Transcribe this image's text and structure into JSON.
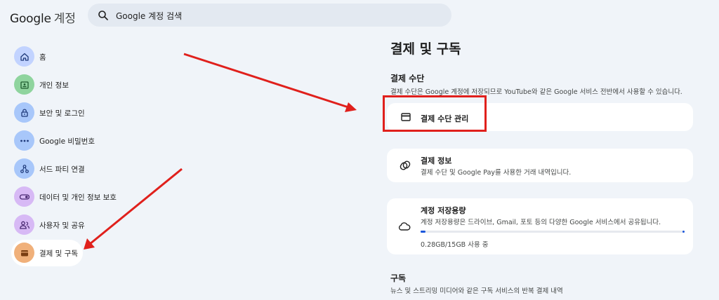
{
  "header": {
    "logo_google": "Google",
    "logo_app": "계정",
    "search_placeholder": "Google 계정 검색"
  },
  "sidebar": {
    "items": [
      {
        "label": "홈",
        "icon": "home-icon",
        "color": "#c2d3ff"
      },
      {
        "label": "개인 정보",
        "icon": "id-card-icon",
        "color": "#8fd49e"
      },
      {
        "label": "보안 및 로그인",
        "icon": "lock-icon",
        "color": "#a8c7fa"
      },
      {
        "label": "Google 비밀번호",
        "icon": "password-icon",
        "color": "#a8c7fa"
      },
      {
        "label": "서드 파티 연결",
        "icon": "connections-icon",
        "color": "#a8c7fa"
      },
      {
        "label": "데이터 및 개인 정보 보호",
        "icon": "toggle-icon",
        "color": "#d7b9f5"
      },
      {
        "label": "사용자 및 공유",
        "icon": "people-icon",
        "color": "#d7b9f5"
      },
      {
        "label": "결제 및 구독",
        "icon": "wallet-icon",
        "color": "#f0b07a",
        "active": true
      }
    ]
  },
  "main": {
    "title": "결제 및 구독",
    "payment_methods": {
      "title": "결제 수단",
      "description": "결제 수단은 Google 계정에 저장되므로 YouTube와 같은 Google 서비스 전반에서 사용할 수 있습니다.",
      "manage_label": "결제 수단 관리"
    },
    "payment_info": {
      "title": "결제 정보",
      "description": "결제 수단 및 Google Pay를 사용한 거래 내역입니다."
    },
    "storage": {
      "title": "계정 저장용량",
      "description": "계정 저장용량은 드라이브, Gmail, 포토 등의 다양한 Google 서비스에서 공유됩니다.",
      "usage_label": "0.28GB/15GB 사용 중",
      "usage_fraction": 0.019
    },
    "subscriptions": {
      "title": "구독",
      "description": "뉴스 및 스트리밍 미디어와 같은 구독 서비스의 반복 결제 내역"
    }
  },
  "colors": {
    "background": "#f0f4f9",
    "card": "#ffffff",
    "annotation_red": "#e0201c",
    "storage_blue": "#1a56db"
  }
}
